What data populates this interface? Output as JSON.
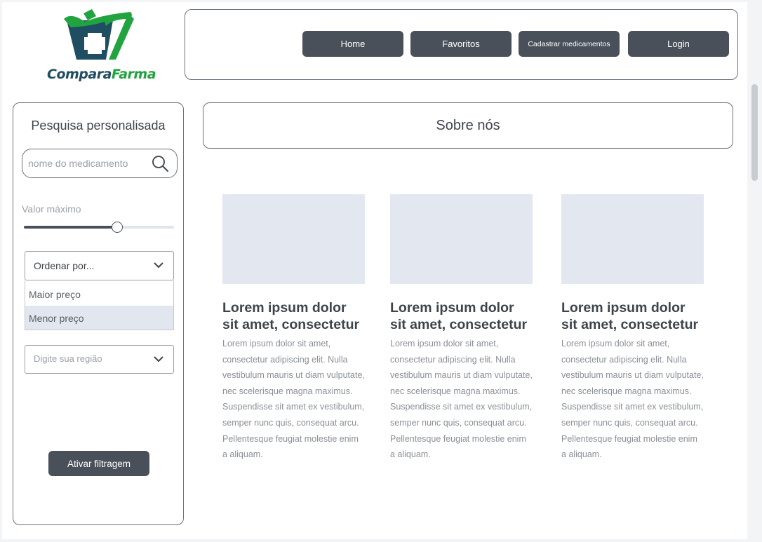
{
  "brand": {
    "name_part1": "Compara",
    "name_part2": "Farma",
    "primary_color": "#1f4e63",
    "accent_color": "#21a33f"
  },
  "nav": {
    "items": [
      {
        "label": "Home"
      },
      {
        "label": "Favoritos"
      },
      {
        "label": "Cadastrar medicamentos"
      },
      {
        "label": "Login"
      }
    ]
  },
  "sidebar": {
    "title": "Pesquisa personalisada",
    "search": {
      "placeholder": "nome do medicamento",
      "value": "",
      "icon": "search-icon"
    },
    "price": {
      "label": "Valor máximo",
      "level_fraction": 0.62
    },
    "sort": {
      "label": "Ordenar por...",
      "icon": "chevron-down-icon",
      "options": [
        {
          "label": "Maior preço"
        },
        {
          "label": "Menor preço"
        }
      ],
      "highlighted_option": "Menor preço"
    },
    "region": {
      "placeholder": "Digite sua região",
      "icon": "chevron-down-icon"
    },
    "filter_button": "Ativar filtragem"
  },
  "main": {
    "section_title": "Sobre nós",
    "cards": [
      {
        "title": "Lorem ipsum dolor sit amet, consectetur",
        "body": "Lorem ipsum dolor sit amet, consectetur adipiscing elit. Nulla vestibulum mauris ut diam vulputate, nec scelerisque magna maximus. Suspendisse sit amet ex vestibulum, semper nunc quis, consequat arcu. Pellentesque feugiat molestie enim a aliquam."
      },
      {
        "title": "Lorem ipsum dolor sit amet, consectetur",
        "body": "Lorem ipsum dolor sit amet, consectetur adipiscing elit. Nulla vestibulum mauris ut diam vulputate, nec scelerisque magna maximus. Suspendisse sit amet ex vestibulum, semper nunc quis, consequat arcu. Pellentesque feugiat molestie enim a aliquam."
      },
      {
        "title": "Lorem ipsum dolor sit amet, consectetur",
        "body": "Lorem ipsum dolor sit amet, consectetur adipiscing elit. Nulla vestibulum mauris ut diam vulputate, nec scelerisque magna maximus. Suspendisse sit amet ex vestibulum, semper nunc quis, consequat arcu. Pellentesque feugiat molestie enim a aliquam."
      }
    ],
    "image_placeholder_color": "#e3e7ef"
  }
}
